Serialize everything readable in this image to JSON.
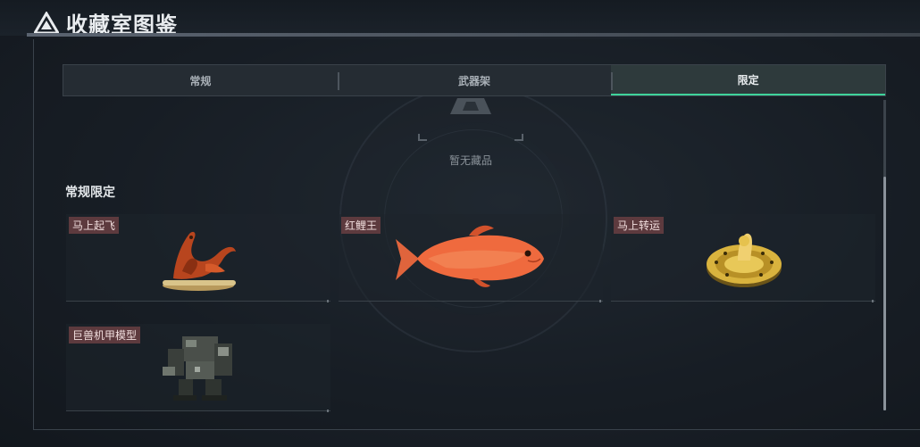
{
  "header": {
    "title": "收藏室图鉴"
  },
  "tabs": [
    {
      "label": "常规",
      "active": false
    },
    {
      "label": "武器架",
      "active": false
    },
    {
      "label": "限定",
      "active": true
    }
  ],
  "empty_state": {
    "text": "暂无藏品"
  },
  "section": {
    "title": "常规限定",
    "items": [
      {
        "label": "马上起飞",
        "icon": "golden-horse-figurine"
      },
      {
        "label": "红鲤王",
        "icon": "red-carp-fish"
      },
      {
        "label": "马上转运",
        "icon": "golden-horse-coin-disc"
      },
      {
        "label": "巨兽机甲模型",
        "icon": "mech-model"
      }
    ]
  },
  "colors": {
    "tab_active_underline": "#3fd39b",
    "label_bg": "#5d3a3e"
  }
}
